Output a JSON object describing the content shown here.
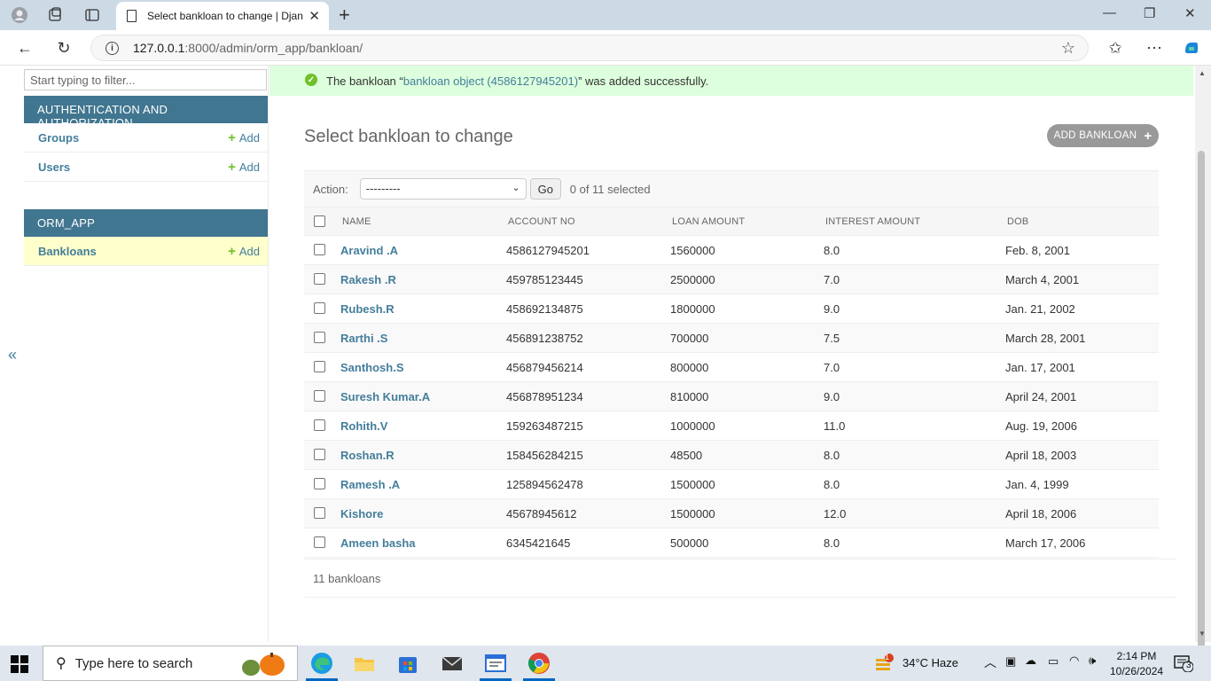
{
  "browser": {
    "tab_title": "Select bankloan to change | Djang",
    "url_host": "127.0.0.1",
    "url_path": ":8000/admin/orm_app/bankloan/"
  },
  "sidebar": {
    "filter_placeholder": "Start typing to filter...",
    "modules": [
      {
        "caption": "AUTHENTICATION AND AUTHORIZATION",
        "models": [
          {
            "name": "Groups",
            "add": "Add"
          },
          {
            "name": "Users",
            "add": "Add"
          }
        ]
      },
      {
        "caption": "ORM_APP",
        "models": [
          {
            "name": "Bankloans",
            "add": "Add"
          }
        ]
      }
    ],
    "toggle": "«"
  },
  "message": {
    "prefix": "The bankloan “",
    "link": "bankloan object (4586127945201)",
    "suffix": "” was added successfully."
  },
  "page": {
    "title": "Select bankloan to change",
    "add_button": "ADD BANKLOAN"
  },
  "actions": {
    "label": "Action:",
    "selected": "---------",
    "go": "Go",
    "counter": "0 of 11 selected"
  },
  "table": {
    "headers": [
      "NAME",
      "ACCOUNT NO",
      "LOAN AMOUNT",
      "INTEREST AMOUNT",
      "DOB"
    ],
    "rows": [
      [
        "Aravind .A",
        "4586127945201",
        "1560000",
        "8.0",
        "Feb. 8, 2001"
      ],
      [
        "Rakesh .R",
        "459785123445",
        "2500000",
        "7.0",
        "March 4, 2001"
      ],
      [
        "Rubesh.R",
        "458692134875",
        "1800000",
        "9.0",
        "Jan. 21, 2002"
      ],
      [
        "Rarthi .S",
        "456891238752",
        "700000",
        "7.5",
        "March 28, 2001"
      ],
      [
        "Santhosh.S",
        "456879456214",
        "800000",
        "7.0",
        "Jan. 17, 2001"
      ],
      [
        "Suresh Kumar.A",
        "456878951234",
        "810000",
        "9.0",
        "April 24, 2001"
      ],
      [
        "Rohith.V",
        "159263487215",
        "1000000",
        "11.0",
        "Aug. 19, 2006"
      ],
      [
        "Roshan.R",
        "158456284215",
        "48500",
        "8.0",
        "April 18, 2003"
      ],
      [
        "Ramesh .A",
        "125894562478",
        "1500000",
        "8.0",
        "Jan. 4, 1999"
      ],
      [
        "Kishore",
        "45678945612",
        "1500000",
        "12.0",
        "April 18, 2006"
      ],
      [
        "Ameen basha",
        "6345421645",
        "500000",
        "8.0",
        "March 17, 2006"
      ]
    ]
  },
  "paginator": "11 bankloans",
  "taskbar": {
    "search_placeholder": "Type here to search",
    "weather": "34°C  Haze",
    "time": "2:14 PM",
    "date": "10/26/2024",
    "notification_count": "3",
    "weather_badge": "1"
  },
  "colors": {
    "header_blue": "#417690",
    "link_blue": "#447e9b",
    "success_bg": "#ddffdd",
    "add_green": "#70bf2b"
  }
}
